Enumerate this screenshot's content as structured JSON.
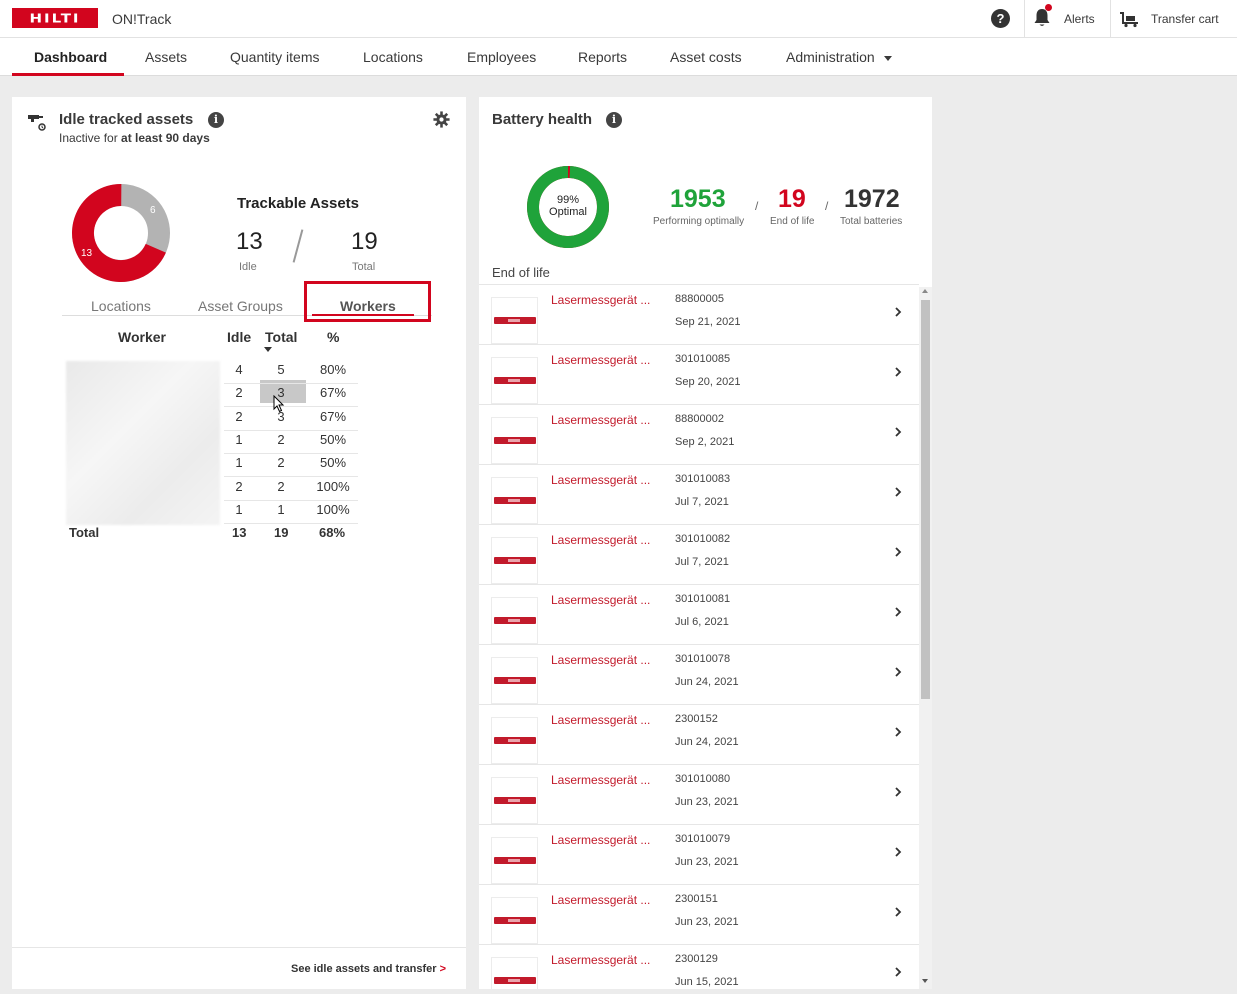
{
  "topbar": {
    "logo": "HILTI",
    "app_name": "ON!Track",
    "help": "?",
    "alerts": "Alerts",
    "transfer_cart": "Transfer cart",
    "icons": [
      "help-icon",
      "bell-icon",
      "cart-icon"
    ],
    "accent_color": "#d2051e"
  },
  "nav": {
    "items": [
      "Dashboard",
      "Assets",
      "Quantity items",
      "Locations",
      "Employees",
      "Reports",
      "Asset costs",
      "Administration"
    ],
    "active": "Dashboard"
  },
  "idle_card": {
    "title": "Idle tracked assets",
    "subtitle_prefix": "Inactive for",
    "subtitle_bold": "at least 90 days",
    "donut": {
      "idle": 13,
      "other": 6,
      "idle_label": "13",
      "other_label": "6",
      "idle_color": "#d2051e",
      "other_color": "#b3b3b3"
    },
    "trackable_title": "Trackable Assets",
    "idle_value": "13",
    "idle_label": "Idle",
    "total_value": "19",
    "total_label": "Total",
    "tabs": [
      "Locations",
      "Asset Groups",
      "Workers"
    ],
    "active_tab": "Workers",
    "columns": {
      "worker": "Worker",
      "idle": "Idle",
      "total": "Total",
      "pct": "%"
    },
    "rows": [
      {
        "idle": "4",
        "total": "5",
        "pct": "80%"
      },
      {
        "idle": "2",
        "total": "3",
        "pct": "67%"
      },
      {
        "idle": "2",
        "total": "3",
        "pct": "67%"
      },
      {
        "idle": "1",
        "total": "2",
        "pct": "50%"
      },
      {
        "idle": "1",
        "total": "2",
        "pct": "50%"
      },
      {
        "idle": "2",
        "total": "2",
        "pct": "100%"
      },
      {
        "idle": "1",
        "total": "1",
        "pct": "100%"
      }
    ],
    "total_row": {
      "label": "Total",
      "idle": "13",
      "total": "19",
      "pct": "68%"
    },
    "footer_link": "See idle assets and transfer",
    "footer_arrow": ">"
  },
  "battery_card": {
    "title": "Battery health",
    "donut": {
      "pct_label": "99%",
      "status_label": "Optimal",
      "optimal_color": "#1fa33a",
      "eol_color": "#d2051e",
      "optimal_fraction": 0.99
    },
    "performing_value": "1953",
    "performing_label": "Performing optimally",
    "eol_value": "19",
    "eol_label": "End of life",
    "total_value": "1972",
    "total_label": "Total batteries",
    "separator": "/",
    "list_title": "End of life",
    "items": [
      {
        "name": "Lasermessgerät ...",
        "id": "88800005",
        "date": "Sep 21, 2021"
      },
      {
        "name": "Lasermessgerät ...",
        "id": "301010085",
        "date": "Sep 20, 2021"
      },
      {
        "name": "Lasermessgerät ...",
        "id": "88800002",
        "date": "Sep 2, 2021"
      },
      {
        "name": "Lasermessgerät ...",
        "id": "301010083",
        "date": "Jul 7, 2021"
      },
      {
        "name": "Lasermessgerät ...",
        "id": "301010082",
        "date": "Jul 7, 2021"
      },
      {
        "name": "Lasermessgerät ...",
        "id": "301010081",
        "date": "Jul 6, 2021"
      },
      {
        "name": "Lasermessgerät ...",
        "id": "301010078",
        "date": "Jun 24, 2021"
      },
      {
        "name": "Lasermessgerät ...",
        "id": "2300152",
        "date": "Jun 24, 2021"
      },
      {
        "name": "Lasermessgerät ...",
        "id": "301010080",
        "date": "Jun 23, 2021"
      },
      {
        "name": "Lasermessgerät ...",
        "id": "301010079",
        "date": "Jun 23, 2021"
      },
      {
        "name": "Lasermessgerät ...",
        "id": "2300151",
        "date": "Jun 23, 2021"
      },
      {
        "name": "Lasermessgerät ...",
        "id": "2300129",
        "date": "Jun 15, 2021"
      }
    ]
  }
}
